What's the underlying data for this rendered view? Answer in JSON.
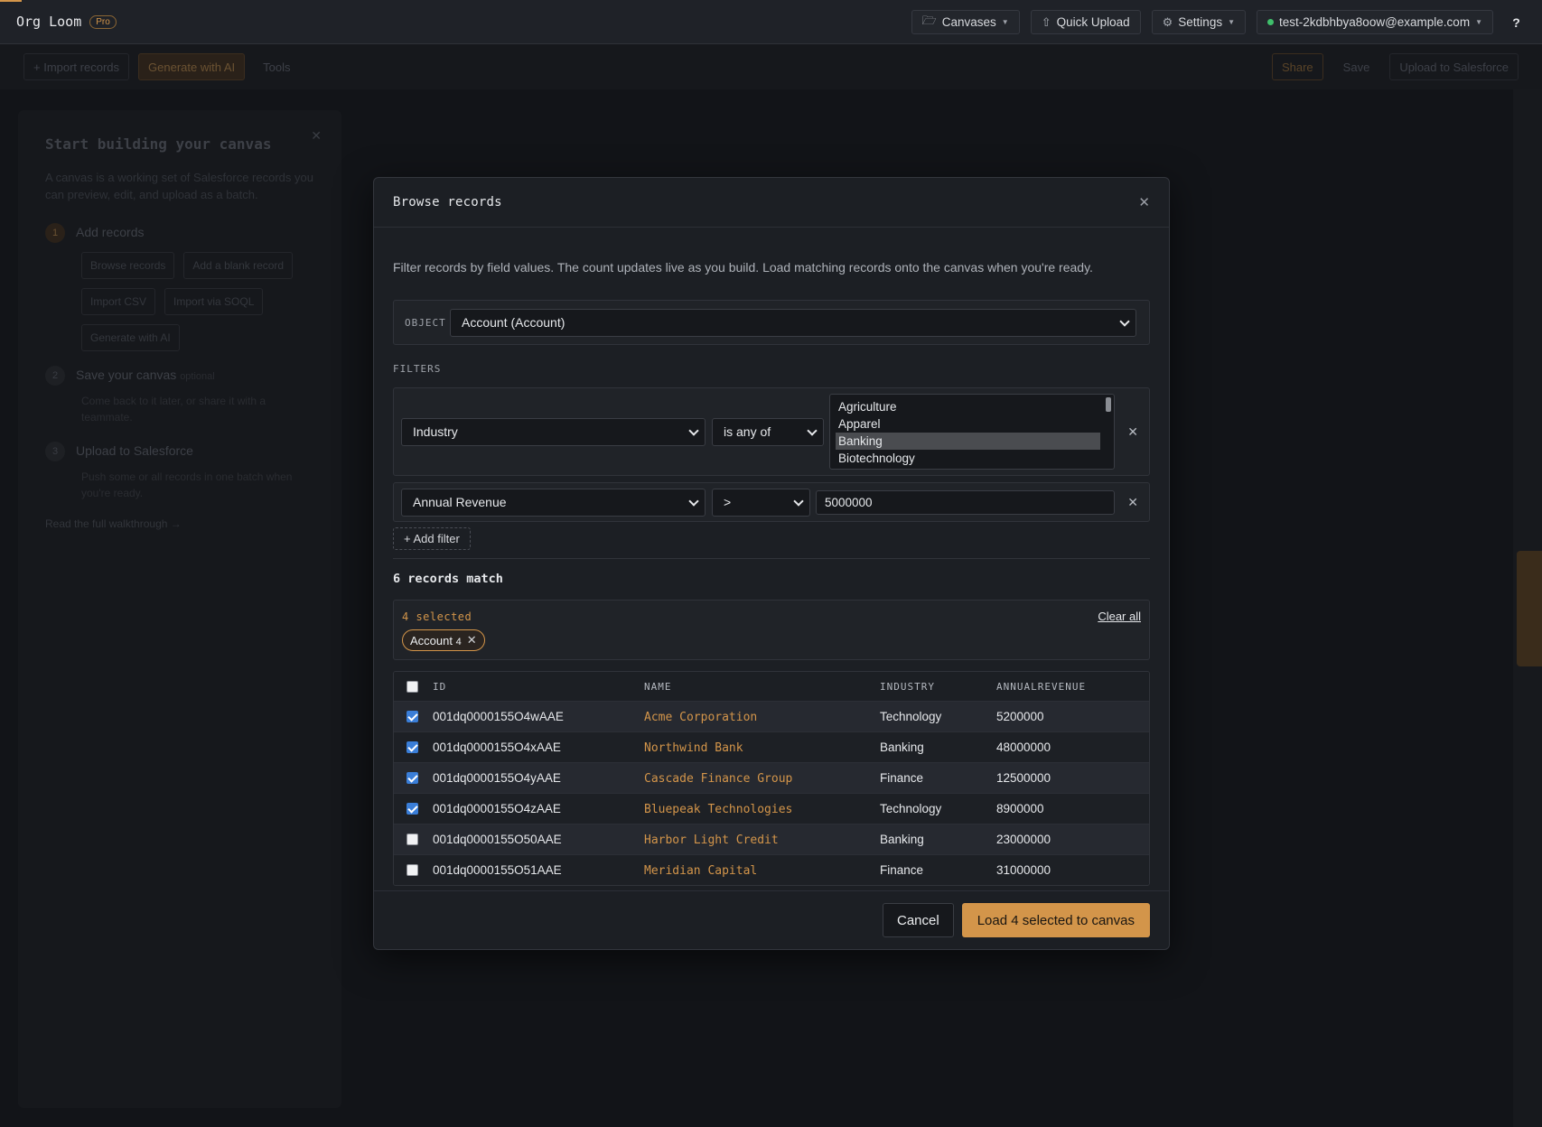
{
  "topbar": {
    "brand": "Org Loom",
    "badge": "Pro",
    "canvases_label": "Canvases",
    "quick_upload_label": "Quick Upload",
    "settings_label": "Settings",
    "user_email": "test-2kdbhbya8oow@example.com",
    "help_label": "?"
  },
  "background": {
    "toolbar": {
      "import_label": "+ Import records",
      "generate_label": "Generate with AI",
      "tools_label": "Tools",
      "share_label": "Share",
      "save_label": "Save",
      "upload_label": "Upload to Salesforce"
    },
    "panel": {
      "title": "Start building your canvas",
      "text": "A canvas is a working set of Salesforce records you can preview, edit, and upload as a batch.",
      "step1_num": "1",
      "step1_title": "Add records",
      "chips": [
        "Browse records",
        "Add a blank record",
        "Import CSV",
        "Import via SOQL",
        "Generate with AI"
      ],
      "step2_num": "2",
      "step2_title": "Save your canvas",
      "step2_hint": "optional",
      "step2_text": "Come back to it later, or share it with a teammate.",
      "step3_num": "3",
      "step3_title": "Upload to Salesforce",
      "step3_text": "Push some or all records in one batch when you're ready.",
      "link": "Read the full walkthrough →"
    }
  },
  "modal": {
    "title": "Browse records",
    "description": "Filter records by field values. The count updates live as you build. Load matching records onto the canvas when you're ready.",
    "object_label": "OBJECT",
    "object_value": "Account (Account)",
    "filters_label": "FILTERS",
    "filters": [
      {
        "field": "Industry",
        "operator": "is any of",
        "options": [
          "Agriculture",
          "Apparel",
          "Banking",
          "Biotechnology"
        ],
        "selected_option": "Banking"
      },
      {
        "field": "Annual Revenue",
        "operator": ">",
        "value": "5000000"
      }
    ],
    "add_filter_label": "+ Add filter",
    "match_count": "6 records match",
    "selection": {
      "count_label": "4 selected",
      "clear_label": "Clear all",
      "chip_label": "Account",
      "chip_count": "4"
    },
    "table": {
      "headers": {
        "id": "ID",
        "name": "NAME",
        "industry": "INDUSTRY",
        "revenue": "ANNUALREVENUE"
      },
      "rows": [
        {
          "id": "001dq0000155O4wAAE",
          "name": "Acme Corporation",
          "industry": "Technology",
          "revenue": "5200000",
          "checked": true
        },
        {
          "id": "001dq0000155O4xAAE",
          "name": "Northwind Bank",
          "industry": "Banking",
          "revenue": "48000000",
          "checked": true
        },
        {
          "id": "001dq0000155O4yAAE",
          "name": "Cascade Finance Group",
          "industry": "Finance",
          "revenue": "12500000",
          "checked": true
        },
        {
          "id": "001dq0000155O4zAAE",
          "name": "Bluepeak Technologies",
          "industry": "Technology",
          "revenue": "8900000",
          "checked": true
        },
        {
          "id": "001dq0000155O50AAE",
          "name": "Harbor Light Credit",
          "industry": "Banking",
          "revenue": "23000000",
          "checked": false
        },
        {
          "id": "001dq0000155O51AAE",
          "name": "Meridian Capital",
          "industry": "Finance",
          "revenue": "31000000",
          "checked": false
        }
      ]
    },
    "cancel_label": "Cancel",
    "load_label": "Load 4 selected to canvas"
  },
  "colors": {
    "accent": "#d3954a",
    "background": "#121418",
    "modal": "#1c1f24",
    "checkbox_on": "#3a7ed8"
  }
}
